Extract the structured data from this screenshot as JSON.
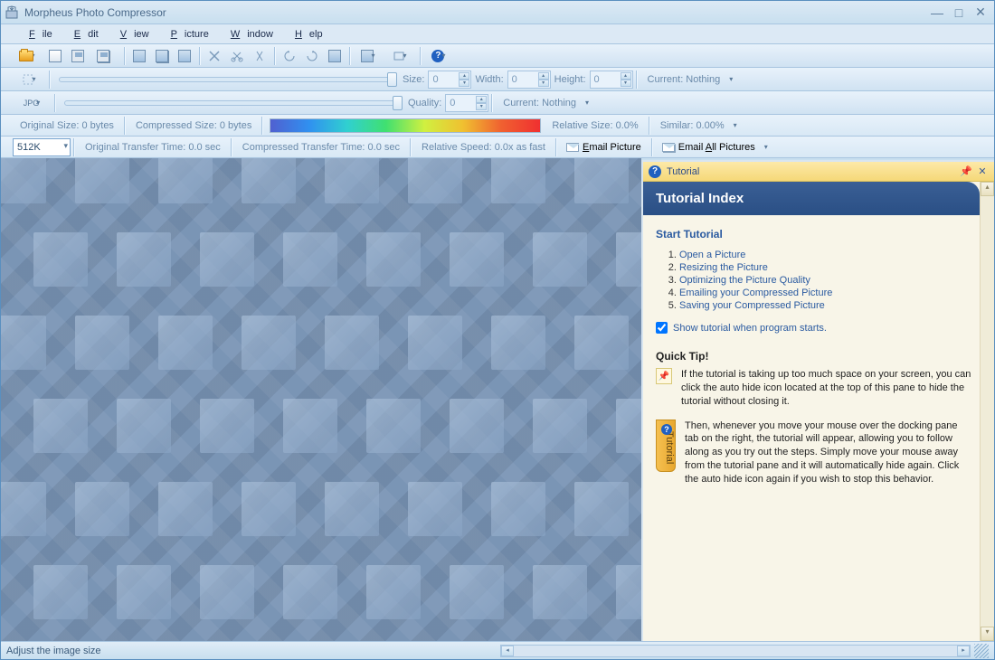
{
  "window": {
    "title": "Morpheus Photo Compressor"
  },
  "menu": {
    "file": "File",
    "file_u": "F",
    "edit": "Edit",
    "edit_u": "E",
    "view": "View",
    "view_u": "V",
    "picture": "Picture",
    "picture_u": "P",
    "window": "Window",
    "window_u": "W",
    "help": "Help",
    "help_u": "H"
  },
  "size_row": {
    "size_label": "Size:",
    "size_val": "0",
    "width_label": "Width:",
    "width_val": "0",
    "height_label": "Height:",
    "height_val": "0",
    "current": "Current: Nothing"
  },
  "format_row": {
    "format": "JPG",
    "quality_label": "Quality:",
    "quality_val": "0",
    "current": "Current: Nothing"
  },
  "stats_row": {
    "orig_size": "Original Size: 0 bytes",
    "comp_size": "Compressed Size: 0 bytes",
    "rel_size": "Relative Size: 0.0%",
    "similar": "Similar: 0.00%"
  },
  "transfer_row": {
    "speed": "512K",
    "orig_time": "Original Transfer Time: 0.0 sec",
    "comp_time": "Compressed Transfer Time: 0.0 sec",
    "rel_speed": "Relative Speed: 0.0x as fast",
    "email_picture": "Email Picture",
    "email_picture_u": "E",
    "email_all": "Email All Pictures",
    "email_all_u": "A"
  },
  "tutorial": {
    "pane_title": "Tutorial",
    "header": "Tutorial Index",
    "start": "Start Tutorial",
    "steps": [
      "Open a Picture",
      "Resizing the Picture",
      "Optimizing the Picture Quality",
      "Emailing your Compressed Picture",
      "Saving your Compressed Picture"
    ],
    "show_on_start": "Show tutorial when program starts.",
    "quick_tip": "Quick Tip!",
    "tip1": "If the tutorial is taking up too much space on your screen, you can click the auto hide icon located at the top of this pane to hide the tutorial without closing it.",
    "tip2": "Then, whenever you move your mouse over the docking pane tab on the right, the tutorial will appear, allowing you to follow along as you try out the steps. Simply move your mouse away from the tutorial pane and it will automatically hide again. Click the auto hide icon again if you wish to stop this behavior.",
    "tab_label": "Tutorial"
  },
  "statusbar": {
    "text": "Adjust the image size"
  }
}
